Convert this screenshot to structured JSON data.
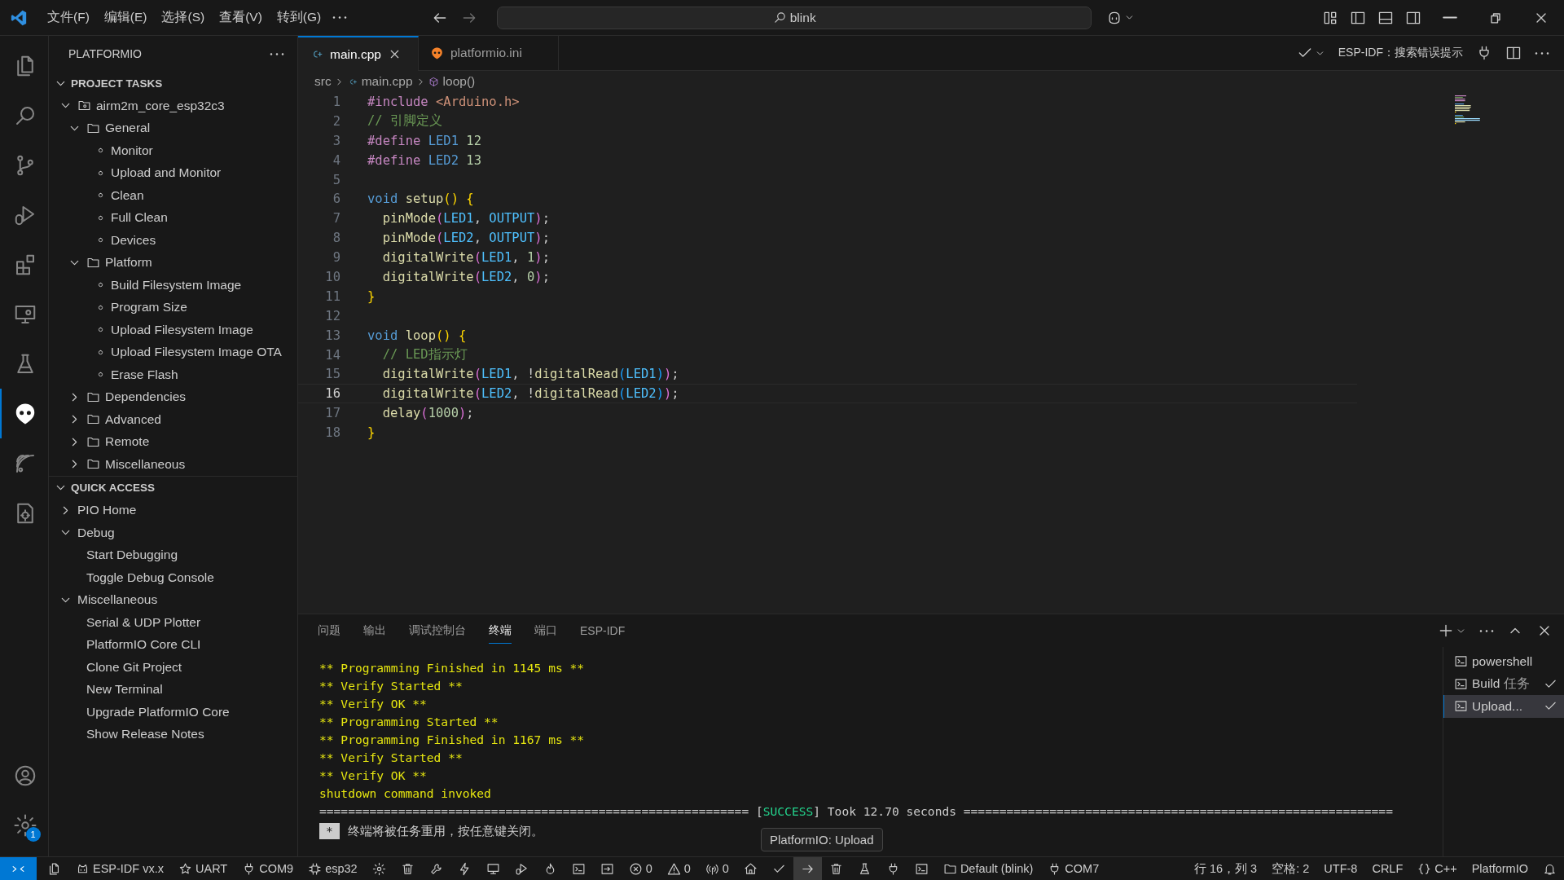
{
  "title_bar": {
    "menus": [
      "文件(F)",
      "编辑(E)",
      "选择(S)",
      "查看(V)",
      "转到(G)"
    ],
    "search": {
      "value": "blink"
    }
  },
  "activity_bar": {
    "items": [
      {
        "kind": "files",
        "selected": false
      },
      {
        "kind": "search",
        "selected": false
      },
      {
        "kind": "branch",
        "selected": false
      },
      {
        "kind": "rundebug",
        "selected": false
      },
      {
        "kind": "blocks",
        "selected": false
      },
      {
        "kind": "remotemon",
        "selected": false
      },
      {
        "kind": "flask",
        "selected": false
      },
      {
        "kind": "alien",
        "selected": true
      },
      {
        "kind": "waves",
        "selected": false
      },
      {
        "kind": "docgear",
        "selected": false
      }
    ],
    "bottom": [
      {
        "kind": "person"
      },
      {
        "kind": "gear",
        "badge": "1"
      }
    ]
  },
  "sidebar": {
    "title": "PLATFORMIO",
    "sections": [
      {
        "title": "PROJECT TASKS",
        "expanded": true,
        "items": [
          {
            "label": "airm2m_core_esp32c3",
            "kind": "project",
            "expanded": true,
            "children": [
              {
                "label": "General",
                "kind": "folder",
                "expanded": true,
                "children": [
                  {
                    "label": "Monitor",
                    "kind": "task"
                  },
                  {
                    "label": "Upload and Monitor",
                    "kind": "task"
                  },
                  {
                    "label": "Clean",
                    "kind": "task"
                  },
                  {
                    "label": "Full Clean",
                    "kind": "task"
                  },
                  {
                    "label": "Devices",
                    "kind": "task"
                  }
                ]
              },
              {
                "label": "Platform",
                "kind": "folder",
                "expanded": true,
                "children": [
                  {
                    "label": "Build Filesystem Image",
                    "kind": "task"
                  },
                  {
                    "label": "Program Size",
                    "kind": "task"
                  },
                  {
                    "label": "Upload Filesystem Image",
                    "kind": "task"
                  },
                  {
                    "label": "Upload Filesystem Image OTA",
                    "kind": "task"
                  },
                  {
                    "label": "Erase Flash",
                    "kind": "task"
                  }
                ]
              },
              {
                "label": "Dependencies",
                "kind": "folder",
                "expanded": false
              },
              {
                "label": "Advanced",
                "kind": "folder",
                "expanded": false
              },
              {
                "label": "Remote",
                "kind": "folder",
                "expanded": false
              },
              {
                "label": "Miscellaneous",
                "kind": "folder",
                "expanded": false
              }
            ]
          }
        ]
      },
      {
        "title": "QUICK ACCESS",
        "expanded": true,
        "items": [
          {
            "label": "PIO Home",
            "kind": "group",
            "expanded": false
          },
          {
            "label": "Debug",
            "kind": "group",
            "expanded": true,
            "children": [
              {
                "label": "Start Debugging",
                "kind": "action"
              },
              {
                "label": "Toggle Debug Console",
                "kind": "action"
              }
            ]
          },
          {
            "label": "Miscellaneous",
            "kind": "group",
            "expanded": true,
            "children": [
              {
                "label": "Serial & UDP Plotter",
                "kind": "action"
              },
              {
                "label": "PlatformIO Core CLI",
                "kind": "action"
              },
              {
                "label": "Clone Git Project",
                "kind": "action"
              },
              {
                "label": "New Terminal",
                "kind": "action"
              },
              {
                "label": "Upgrade PlatformIO Core",
                "kind": "action"
              },
              {
                "label": "Show Release Notes",
                "kind": "action"
              }
            ]
          }
        ]
      }
    ]
  },
  "editor": {
    "tabs": [
      {
        "label": "main.cpp",
        "kind": "cpp",
        "selected": true
      },
      {
        "label": "platformio.ini",
        "kind": "ini",
        "selected": false
      }
    ],
    "action_label": "ESP-IDF：搜索错误提示",
    "breadcrumbs": [
      {
        "label": "src",
        "kind": "folder"
      },
      {
        "label": "main.cpp",
        "kind": "file"
      },
      {
        "label": "loop()",
        "kind": "symbol"
      }
    ],
    "lines": [
      {
        "number": "1",
        "current": false,
        "tokens": [
          {
            "text": "#include ",
            "kind": "dir"
          },
          {
            "text": "<Arduino.h>",
            "kind": "str"
          }
        ]
      },
      {
        "number": "2",
        "current": false,
        "tokens": [
          {
            "text": "// 引脚定义",
            "kind": "com"
          }
        ]
      },
      {
        "number": "3",
        "current": false,
        "tokens": [
          {
            "text": "#define ",
            "kind": "dir"
          },
          {
            "text": "LED1 ",
            "kind": "mac"
          },
          {
            "text": "12",
            "kind": "num"
          }
        ]
      },
      {
        "number": "4",
        "current": false,
        "tokens": [
          {
            "text": "#define ",
            "kind": "dir"
          },
          {
            "text": "LED2 ",
            "kind": "mac"
          },
          {
            "text": "13",
            "kind": "num"
          }
        ]
      },
      {
        "number": "5",
        "current": false
      },
      {
        "number": "6",
        "current": false,
        "tokens": [
          {
            "text": "void ",
            "kind": "kw"
          },
          {
            "text": "setup",
            "kind": "fn"
          },
          {
            "text": "() {",
            "kind": "b1"
          }
        ]
      },
      {
        "number": "7",
        "current": false,
        "tokens": [
          {
            "text": "  pinMode",
            "kind": "fn"
          },
          {
            "text": "(",
            "kind": "b2"
          },
          {
            "text": "LED1",
            "kind": "con"
          },
          {
            "text": ", ",
            "kind": "p"
          },
          {
            "text": "OUTPUT",
            "kind": "con"
          },
          {
            "text": ")",
            "kind": "b2"
          },
          {
            "text": ";",
            "kind": "p"
          }
        ]
      },
      {
        "number": "8",
        "current": false,
        "tokens": [
          {
            "text": "  pinMode",
            "kind": "fn"
          },
          {
            "text": "(",
            "kind": "b2"
          },
          {
            "text": "LED2",
            "kind": "con"
          },
          {
            "text": ", ",
            "kind": "p"
          },
          {
            "text": "OUTPUT",
            "kind": "con"
          },
          {
            "text": ")",
            "kind": "b2"
          },
          {
            "text": ";",
            "kind": "p"
          }
        ]
      },
      {
        "number": "9",
        "current": false,
        "tokens": [
          {
            "text": "  digitalWrite",
            "kind": "fn"
          },
          {
            "text": "(",
            "kind": "b2"
          },
          {
            "text": "LED1",
            "kind": "con"
          },
          {
            "text": ", ",
            "kind": "p"
          },
          {
            "text": "1",
            "kind": "num"
          },
          {
            "text": ")",
            "kind": "b2"
          },
          {
            "text": ";",
            "kind": "p"
          }
        ]
      },
      {
        "number": "10",
        "current": false,
        "tokens": [
          {
            "text": "  digitalWrite",
            "kind": "fn"
          },
          {
            "text": "(",
            "kind": "b2"
          },
          {
            "text": "LED2",
            "kind": "con"
          },
          {
            "text": ", ",
            "kind": "p"
          },
          {
            "text": "0",
            "kind": "num"
          },
          {
            "text": ")",
            "kind": "b2"
          },
          {
            "text": ";",
            "kind": "p"
          }
        ]
      },
      {
        "number": "11",
        "current": false,
        "tokens": [
          {
            "text": "}",
            "kind": "b1"
          }
        ]
      },
      {
        "number": "12",
        "current": false
      },
      {
        "number": "13",
        "current": false,
        "tokens": [
          {
            "text": "void ",
            "kind": "kw"
          },
          {
            "text": "loop",
            "kind": "fn"
          },
          {
            "text": "() {",
            "kind": "b1"
          }
        ]
      },
      {
        "number": "14",
        "current": false,
        "tokens": [
          {
            "text": "  // LED指示灯",
            "kind": "com"
          }
        ]
      },
      {
        "number": "15",
        "current": false,
        "tokens": [
          {
            "text": "  digitalWrite",
            "kind": "fn"
          },
          {
            "text": "(",
            "kind": "b2"
          },
          {
            "text": "LED1",
            "kind": "con"
          },
          {
            "text": ", !",
            "kind": "p"
          },
          {
            "text": "digitalRead",
            "kind": "fn"
          },
          {
            "text": "(",
            "kind": "b3"
          },
          {
            "text": "LED1",
            "kind": "con"
          },
          {
            "text": ")",
            "kind": "b3"
          },
          {
            "text": ")",
            "kind": "b2"
          },
          {
            "text": ";",
            "kind": "p"
          }
        ]
      },
      {
        "number": "16",
        "current": true,
        "tokens": [
          {
            "text": "  digitalWrite",
            "kind": "fn"
          },
          {
            "text": "(",
            "kind": "b2"
          },
          {
            "text": "LED2",
            "kind": "con"
          },
          {
            "text": ", !",
            "kind": "p"
          },
          {
            "text": "digitalRead",
            "kind": "fn"
          },
          {
            "text": "(",
            "kind": "b3"
          },
          {
            "text": "LED2",
            "kind": "con"
          },
          {
            "text": ")",
            "kind": "b3"
          },
          {
            "text": ")",
            "kind": "b2"
          },
          {
            "text": ";",
            "kind": "p"
          }
        ]
      },
      {
        "number": "17",
        "current": false,
        "tokens": [
          {
            "text": "  delay",
            "kind": "fn"
          },
          {
            "text": "(",
            "kind": "b2"
          },
          {
            "text": "1000",
            "kind": "num"
          },
          {
            "text": ")",
            "kind": "b2"
          },
          {
            "text": ";",
            "kind": "p"
          }
        ]
      },
      {
        "number": "18",
        "current": false,
        "tokens": [
          {
            "text": "}",
            "kind": "b1"
          }
        ]
      }
    ]
  },
  "panel": {
    "tabs": [
      {
        "label": "问题",
        "selected": false
      },
      {
        "label": "输出",
        "selected": false
      },
      {
        "label": "调试控制台",
        "selected": false
      },
      {
        "label": "终端",
        "selected": true
      },
      {
        "label": "端口",
        "selected": false
      },
      {
        "label": "ESP-IDF",
        "selected": false
      }
    ],
    "terminal_lines": [
      [
        {
          "text": "** Programming Finished in 1145 ms **",
          "kind": "yellow"
        }
      ],
      [
        {
          "text": "** Verify Started **",
          "kind": "yellow"
        }
      ],
      [
        {
          "text": "** Verify OK **",
          "kind": "yellow"
        }
      ],
      [
        {
          "text": "** Programming Started **",
          "kind": "yellow"
        }
      ],
      [
        {
          "text": "** Programming Finished in 1167 ms **",
          "kind": "yellow"
        }
      ],
      [
        {
          "text": "** Verify Started **",
          "kind": "yellow"
        }
      ],
      [
        {
          "text": "** Verify OK **",
          "kind": "yellow"
        }
      ],
      [
        {
          "text": "shutdown command invoked",
          "kind": "yellow"
        }
      ],
      [
        {
          "text": "============================================================ [",
          "kind": "plain"
        },
        {
          "text": "SUCCESS",
          "kind": "green"
        },
        {
          "text": "] Took 12.70 seconds ============================================================",
          "kind": "plain"
        }
      ]
    ],
    "notice": {
      "badge": "*",
      "text": "终端将被任务重用，按任意键关闭。"
    },
    "terminals": [
      {
        "label": "powershell",
        "done": false,
        "selected": false
      },
      {
        "label": "Build",
        "tag": "任务",
        "done": true,
        "selected": false
      },
      {
        "label": "Upload...",
        "done": true,
        "selected": true
      }
    ]
  },
  "tooltip": "PlatformIO: Upload",
  "status_bar": {
    "left": [
      {
        "kind": "remote",
        "highlighted": false
      },
      {
        "kind": "files",
        "highlighted": false
      },
      {
        "kind": "robot",
        "text": "ESP-IDF vx.x",
        "highlighted": false
      },
      {
        "kind": "star",
        "text": "UART",
        "highlighted": false
      },
      {
        "kind": "plug",
        "text": "COM9",
        "highlighted": false
      },
      {
        "kind": "chip",
        "text": "esp32",
        "highlighted": false
      },
      {
        "kind": "gear",
        "highlighted": false
      },
      {
        "kind": "trash",
        "highlighted": false
      },
      {
        "kind": "wrench",
        "highlighted": false
      },
      {
        "kind": "lightning",
        "highlighted": false
      },
      {
        "kind": "monitor",
        "highlighted": false
      },
      {
        "kind": "rundebug",
        "highlighted": false
      },
      {
        "kind": "flame",
        "highlighted": false
      },
      {
        "kind": "terminal",
        "highlighted": false
      },
      {
        "kind": "arrowbox",
        "highlighted": false
      },
      {
        "kind": "error",
        "text": "0",
        "highlighted": false
      },
      {
        "kind": "warning",
        "text": "0",
        "highlighted": false
      },
      {
        "kind": "broadcast",
        "text": "0",
        "highlighted": false
      },
      {
        "kind": "home",
        "highlighted": false
      },
      {
        "kind": "check",
        "highlighted": false
      },
      {
        "kind": "arrow",
        "highlighted": true
      },
      {
        "kind": "trash",
        "highlighted": false
      },
      {
        "kind": "flask",
        "highlighted": false
      },
      {
        "kind": "plug",
        "highlighted": false
      },
      {
        "kind": "terminal",
        "highlighted": false
      },
      {
        "kind": "folder",
        "text": "Default (blink)",
        "highlighted": false
      },
      {
        "kind": "plug",
        "text": "COM7",
        "highlighted": false
      }
    ],
    "right": [
      {
        "kind": "text",
        "text": "行 16，列 3"
      },
      {
        "kind": "text",
        "text": "空格: 2"
      },
      {
        "kind": "text",
        "text": "UTF-8"
      },
      {
        "kind": "text",
        "text": "CRLF"
      },
      {
        "kind": "braces",
        "text": "C++"
      },
      {
        "kind": "text",
        "text": "PlatformIO"
      },
      {
        "kind": "bell"
      }
    ]
  }
}
